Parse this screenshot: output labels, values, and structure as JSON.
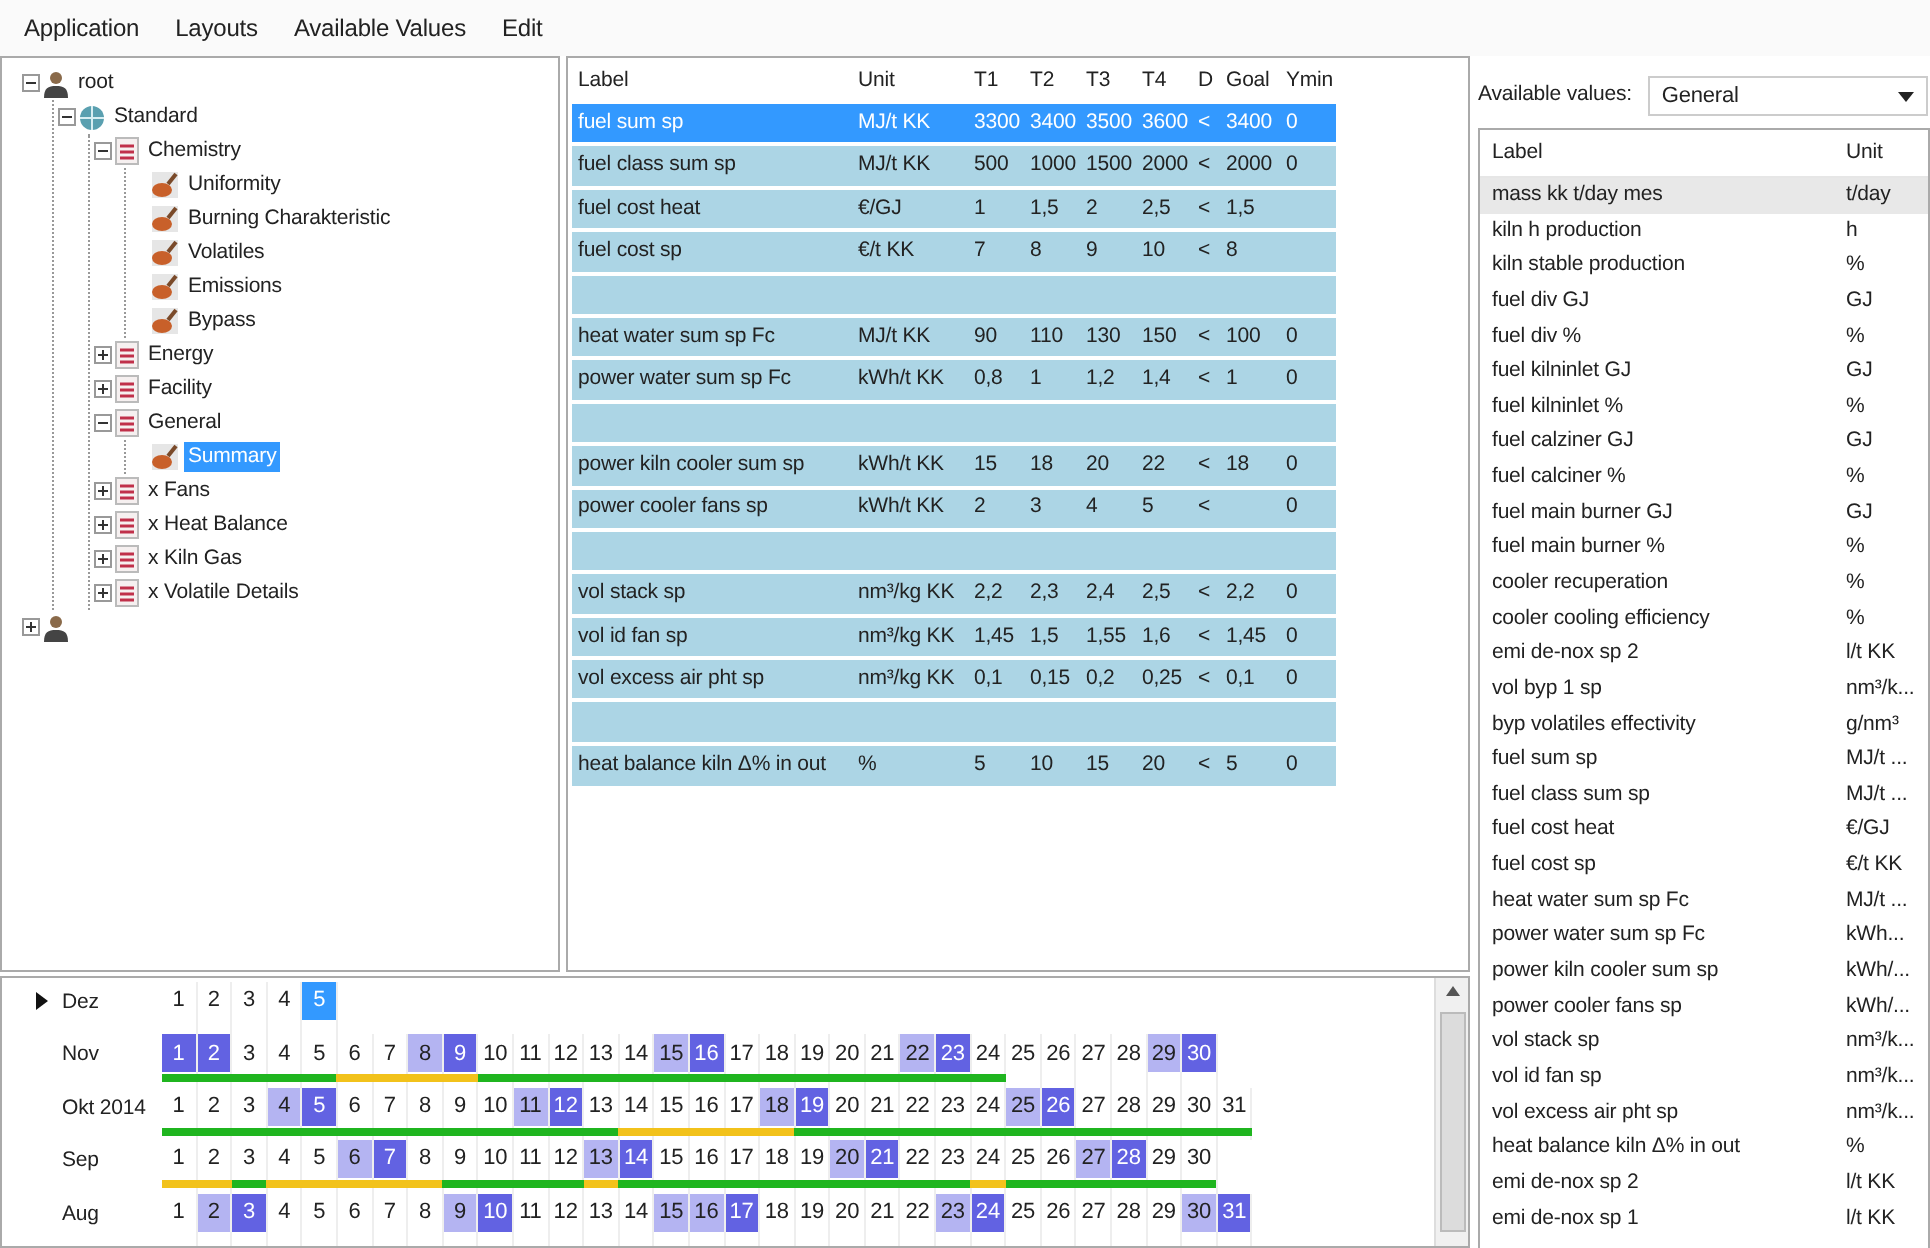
{
  "menu": [
    "Application",
    "Layouts",
    "Available Values",
    "Edit"
  ],
  "tree": [
    {
      "kind": "user",
      "label": "root",
      "expanded": true,
      "selected": false,
      "children": [
        {
          "kind": "model",
          "label": "Standard",
          "expanded": true,
          "selected": false,
          "children": [
            {
              "kind": "group",
              "label": "Chemistry",
              "expanded": true,
              "selected": false,
              "children": [
                {
                  "kind": "item",
                  "label": "Uniformity",
                  "selected": false
                },
                {
                  "kind": "item",
                  "label": "Burning Charakteristic",
                  "selected": false
                },
                {
                  "kind": "item",
                  "label": "Volatiles",
                  "selected": false
                },
                {
                  "kind": "item",
                  "label": "Emissions",
                  "selected": false
                },
                {
                  "kind": "item",
                  "label": "Bypass",
                  "selected": false
                }
              ]
            },
            {
              "kind": "group",
              "label": "Energy",
              "expanded": false,
              "selected": false
            },
            {
              "kind": "group",
              "label": "Facility",
              "expanded": false,
              "selected": false
            },
            {
              "kind": "group",
              "label": "General",
              "expanded": true,
              "selected": false,
              "children": [
                {
                  "kind": "item",
                  "label": "Summary",
                  "selected": true
                }
              ]
            },
            {
              "kind": "group",
              "label": "x Fans",
              "expanded": false,
              "selected": false
            },
            {
              "kind": "group",
              "label": "x Heat Balance",
              "expanded": false,
              "selected": false
            },
            {
              "kind": "group",
              "label": "x Kiln Gas",
              "expanded": false,
              "selected": false
            },
            {
              "kind": "group",
              "label": "x Volatile Details",
              "expanded": false,
              "selected": false
            }
          ]
        }
      ]
    },
    {
      "kind": "user",
      "expanded": false
    }
  ],
  "table": {
    "columns": [
      "Label",
      "Unit",
      "T1",
      "T2",
      "T3",
      "T4",
      "D",
      "Goal",
      "Ymin"
    ],
    "rows": [
      {
        "kind": "data",
        "selected": true,
        "cells": [
          "fuel sum sp",
          "MJ/t KK",
          "3300",
          "3400",
          "3500",
          "3600",
          "<",
          "3400",
          "0"
        ]
      },
      {
        "kind": "data",
        "selected": false,
        "cells": [
          "fuel class sum sp",
          "MJ/t KK",
          "500",
          "1000",
          "1500",
          "2000",
          "<",
          "2000",
          "0"
        ]
      },
      {
        "kind": "data",
        "selected": false,
        "cells": [
          "fuel cost heat",
          "€/GJ",
          "1",
          "1,5",
          "2",
          "2,5",
          "<",
          "1,5",
          null
        ]
      },
      {
        "kind": "data",
        "selected": false,
        "cells": [
          "fuel cost sp",
          "€/t KK",
          "7",
          "8",
          "9",
          "10",
          "<",
          "8",
          null
        ]
      },
      {
        "kind": "blank",
        "selected": false
      },
      {
        "kind": "data",
        "selected": false,
        "cells": [
          "heat water sum sp Fc",
          "MJ/t KK",
          "90",
          "110",
          "130",
          "150",
          "<",
          "100",
          "0"
        ]
      },
      {
        "kind": "data",
        "selected": false,
        "cells": [
          "power water sum sp Fc",
          "kWh/t KK",
          "0,8",
          "1",
          "1,2",
          "1,4",
          "<",
          "1",
          "0"
        ]
      },
      {
        "kind": "blank",
        "selected": false
      },
      {
        "kind": "data",
        "selected": false,
        "cells": [
          "power kiln cooler sum sp",
          "kWh/t KK",
          "15",
          "18",
          "20",
          "22",
          "<",
          "18",
          "0"
        ]
      },
      {
        "kind": "data",
        "selected": false,
        "cells": [
          "power cooler fans sp",
          "kWh/t KK",
          "2",
          "3",
          "4",
          "5",
          "<",
          null,
          "0"
        ]
      },
      {
        "kind": "blank",
        "selected": false
      },
      {
        "kind": "data",
        "selected": false,
        "cells": [
          "vol stack sp",
          "nm³/kg KK",
          "2,2",
          "2,3",
          "2,4",
          "2,5",
          "<",
          "2,2",
          "0"
        ]
      },
      {
        "kind": "data",
        "selected": false,
        "cells": [
          "vol id fan sp",
          "nm³/kg KK",
          "1,45",
          "1,5",
          "1,55",
          "1,6",
          "<",
          "1,45",
          "0"
        ]
      },
      {
        "kind": "data",
        "selected": false,
        "cells": [
          "vol excess air pht sp",
          "nm³/kg KK",
          "0,1",
          "0,15",
          "0,2",
          "0,25",
          "<",
          "0,1",
          "0"
        ]
      },
      {
        "kind": "blank",
        "selected": false
      },
      {
        "kind": "data",
        "selected": false,
        "cells": [
          "heat balance kiln Δ% in out",
          "%",
          "5",
          "10",
          "15",
          "20",
          "<",
          "5",
          "0"
        ]
      }
    ]
  },
  "calendar": {
    "months": [
      {
        "label": "Dez",
        "current": true,
        "days": [
          {
            "day": "1",
            "kind": "plain"
          },
          {
            "day": "2",
            "kind": "plain"
          },
          {
            "day": "3",
            "kind": "plain"
          },
          {
            "day": "4",
            "kind": "plain"
          },
          {
            "day": "5",
            "kind": "current"
          }
        ]
      },
      {
        "label": "Nov",
        "current": false,
        "days": [
          {
            "day": "1",
            "kind": "dark",
            "color": "#1fb51f"
          },
          {
            "day": "2",
            "kind": "dark",
            "color": "#1fb51f"
          },
          {
            "day": "3",
            "kind": "plain",
            "color": "#1fb51f"
          },
          {
            "day": "4",
            "kind": "plain",
            "color": "#1fb51f"
          },
          {
            "day": "5",
            "kind": "plain",
            "color": "#1fb51f"
          },
          {
            "day": "6",
            "kind": "plain",
            "color": "#f2c21b"
          },
          {
            "day": "7",
            "kind": "plain",
            "color": "#f2c21b"
          },
          {
            "day": "8",
            "kind": "light",
            "color": "#f2c21b"
          },
          {
            "day": "9",
            "kind": "dark",
            "color": "#f2c21b"
          },
          {
            "day": "10",
            "kind": "plain",
            "color": "#1fb51f"
          },
          {
            "day": "11",
            "kind": "plain",
            "color": "#1fb51f"
          },
          {
            "day": "12",
            "kind": "plain",
            "color": "#1fb51f"
          },
          {
            "day": "13",
            "kind": "plain",
            "color": "#1fb51f"
          },
          {
            "day": "14",
            "kind": "plain",
            "color": "#1fb51f"
          },
          {
            "day": "15",
            "kind": "light",
            "color": "#1fb51f"
          },
          {
            "day": "16",
            "kind": "dark",
            "color": "#1fb51f"
          },
          {
            "day": "17",
            "kind": "plain",
            "color": "#1fb51f"
          },
          {
            "day": "18",
            "kind": "plain",
            "color": "#1fb51f"
          },
          {
            "day": "19",
            "kind": "plain",
            "color": "#1fb51f"
          },
          {
            "day": "20",
            "kind": "plain",
            "color": "#1fb51f"
          },
          {
            "day": "21",
            "kind": "plain",
            "color": "#1fb51f"
          },
          {
            "day": "22",
            "kind": "light",
            "color": "#1fb51f"
          },
          {
            "day": "23",
            "kind": "dark",
            "color": "#1fb51f"
          },
          {
            "day": "24",
            "kind": "plain",
            "color": "#1fb51f"
          },
          {
            "day": "25",
            "kind": "plain"
          },
          {
            "day": "26",
            "kind": "plain"
          },
          {
            "day": "27",
            "kind": "plain"
          },
          {
            "day": "28",
            "kind": "plain"
          },
          {
            "day": "29",
            "kind": "light"
          },
          {
            "day": "30",
            "kind": "dark"
          }
        ]
      },
      {
        "label": "Okt 2014",
        "current": false,
        "days": [
          {
            "day": "1",
            "kind": "plain",
            "color": "#1fb51f"
          },
          {
            "day": "2",
            "kind": "plain",
            "color": "#1fb51f"
          },
          {
            "day": "3",
            "kind": "plain",
            "color": "#1fb51f"
          },
          {
            "day": "4",
            "kind": "light",
            "color": "#1fb51f"
          },
          {
            "day": "5",
            "kind": "dark",
            "color": "#1fb51f"
          },
          {
            "day": "6",
            "kind": "plain",
            "color": "#1fb51f"
          },
          {
            "day": "7",
            "kind": "plain",
            "color": "#1fb51f"
          },
          {
            "day": "8",
            "kind": "plain",
            "color": "#1fb51f"
          },
          {
            "day": "9",
            "kind": "plain",
            "color": "#1fb51f"
          },
          {
            "day": "10",
            "kind": "plain",
            "color": "#1fb51f"
          },
          {
            "day": "11",
            "kind": "light",
            "color": "#1fb51f"
          },
          {
            "day": "12",
            "kind": "dark",
            "color": "#1fb51f"
          },
          {
            "day": "13",
            "kind": "plain",
            "color": "#1fb51f"
          },
          {
            "day": "14",
            "kind": "plain",
            "color": "#f2c21b"
          },
          {
            "day": "15",
            "kind": "plain",
            "color": "#f2c21b"
          },
          {
            "day": "16",
            "kind": "plain",
            "color": "#f2c21b"
          },
          {
            "day": "17",
            "kind": "plain",
            "color": "#f2c21b"
          },
          {
            "day": "18",
            "kind": "light",
            "color": "#f2c21b"
          },
          {
            "day": "19",
            "kind": "dark",
            "color": "#1fb51f"
          },
          {
            "day": "20",
            "kind": "plain",
            "color": "#1fb51f"
          },
          {
            "day": "21",
            "kind": "plain",
            "color": "#1fb51f"
          },
          {
            "day": "22",
            "kind": "plain",
            "color": "#1fb51f"
          },
          {
            "day": "23",
            "kind": "plain",
            "color": "#1fb51f"
          },
          {
            "day": "24",
            "kind": "plain",
            "color": "#1fb51f"
          },
          {
            "day": "25",
            "kind": "light",
            "color": "#1fb51f"
          },
          {
            "day": "26",
            "kind": "dark",
            "color": "#1fb51f"
          },
          {
            "day": "27",
            "kind": "plain",
            "color": "#1fb51f"
          },
          {
            "day": "28",
            "kind": "plain",
            "color": "#1fb51f"
          },
          {
            "day": "29",
            "kind": "plain",
            "color": "#1fb51f"
          },
          {
            "day": "30",
            "kind": "plain",
            "color": "#1fb51f"
          },
          {
            "day": "31",
            "kind": "plain",
            "color": "#1fb51f"
          }
        ]
      },
      {
        "label": "Sep",
        "current": false,
        "days": [
          {
            "day": "1",
            "kind": "plain",
            "color": "#f2c21b"
          },
          {
            "day": "2",
            "kind": "plain",
            "color": "#f2c21b"
          },
          {
            "day": "3",
            "kind": "plain",
            "color": "#1fb51f"
          },
          {
            "day": "4",
            "kind": "plain",
            "color": "#f2c21b"
          },
          {
            "day": "5",
            "kind": "plain",
            "color": "#f2c21b"
          },
          {
            "day": "6",
            "kind": "light",
            "color": "#f2c21b"
          },
          {
            "day": "7",
            "kind": "dark",
            "color": "#f2c21b"
          },
          {
            "day": "8",
            "kind": "plain",
            "color": "#f2c21b"
          },
          {
            "day": "9",
            "kind": "plain",
            "color": "#1fb51f"
          },
          {
            "day": "10",
            "kind": "plain",
            "color": "#1fb51f"
          },
          {
            "day": "11",
            "kind": "plain",
            "color": "#1fb51f"
          },
          {
            "day": "12",
            "kind": "plain",
            "color": "#1fb51f"
          },
          {
            "day": "13",
            "kind": "light",
            "color": "#f2c21b"
          },
          {
            "day": "14",
            "kind": "dark",
            "color": "#1fb51f"
          },
          {
            "day": "15",
            "kind": "plain",
            "color": "#1fb51f"
          },
          {
            "day": "16",
            "kind": "plain",
            "color": "#1fb51f"
          },
          {
            "day": "17",
            "kind": "plain",
            "color": "#1fb51f"
          },
          {
            "day": "18",
            "kind": "plain",
            "color": "#1fb51f"
          },
          {
            "day": "19",
            "kind": "plain",
            "color": "#1fb51f"
          },
          {
            "day": "20",
            "kind": "light",
            "color": "#1fb51f"
          },
          {
            "day": "21",
            "kind": "dark",
            "color": "#1fb51f"
          },
          {
            "day": "22",
            "kind": "plain",
            "color": "#1fb51f"
          },
          {
            "day": "23",
            "kind": "plain",
            "color": "#1fb51f"
          },
          {
            "day": "24",
            "kind": "plain",
            "color": "#f2c21b"
          },
          {
            "day": "25",
            "kind": "plain",
            "color": "#1fb51f"
          },
          {
            "day": "26",
            "kind": "plain",
            "color": "#1fb51f"
          },
          {
            "day": "27",
            "kind": "light",
            "color": "#1fb51f"
          },
          {
            "day": "28",
            "kind": "dark",
            "color": "#1fb51f"
          },
          {
            "day": "29",
            "kind": "plain",
            "color": "#1fb51f"
          },
          {
            "day": "30",
            "kind": "plain",
            "color": "#1fb51f"
          }
        ]
      },
      {
        "label": "Aug",
        "current": false,
        "days": [
          {
            "day": "1",
            "kind": "plain"
          },
          {
            "day": "2",
            "kind": "light"
          },
          {
            "day": "3",
            "kind": "dark"
          },
          {
            "day": "4",
            "kind": "plain"
          },
          {
            "day": "5",
            "kind": "plain"
          },
          {
            "day": "6",
            "kind": "plain"
          },
          {
            "day": "7",
            "kind": "plain"
          },
          {
            "day": "8",
            "kind": "plain"
          },
          {
            "day": "9",
            "kind": "light"
          },
          {
            "day": "10",
            "kind": "dark"
          },
          {
            "day": "11",
            "kind": "plain"
          },
          {
            "day": "12",
            "kind": "plain"
          },
          {
            "day": "13",
            "kind": "plain"
          },
          {
            "day": "14",
            "kind": "plain"
          },
          {
            "day": "15",
            "kind": "light"
          },
          {
            "day": "16",
            "kind": "light"
          },
          {
            "day": "17",
            "kind": "dark"
          },
          {
            "day": "18",
            "kind": "plain"
          },
          {
            "day": "19",
            "kind": "plain"
          },
          {
            "day": "20",
            "kind": "plain"
          },
          {
            "day": "21",
            "kind": "plain"
          },
          {
            "day": "22",
            "kind": "plain"
          },
          {
            "day": "23",
            "kind": "light"
          },
          {
            "day": "24",
            "kind": "dark"
          },
          {
            "day": "25",
            "kind": "plain"
          },
          {
            "day": "26",
            "kind": "plain"
          },
          {
            "day": "27",
            "kind": "plain"
          },
          {
            "day": "28",
            "kind": "plain"
          },
          {
            "day": "29",
            "kind": "plain"
          },
          {
            "day": "30",
            "kind": "light"
          },
          {
            "day": "31",
            "kind": "dark"
          }
        ]
      }
    ]
  },
  "available": {
    "label": "Available values:",
    "dropdown": "General",
    "columns": [
      "Label",
      "Unit"
    ],
    "rows": [
      {
        "label": "mass kk t/day mes",
        "unit": "t/day",
        "selected": true
      },
      {
        "label": "kiln h production",
        "unit": "h",
        "selected": false
      },
      {
        "label": "kiln stable production",
        "unit": "%",
        "selected": false
      },
      {
        "label": "fuel div GJ",
        "unit": "GJ",
        "selected": false
      },
      {
        "label": "fuel div %",
        "unit": "%",
        "selected": false
      },
      {
        "label": "fuel kilninlet GJ",
        "unit": "GJ",
        "selected": false
      },
      {
        "label": "fuel kilninlet %",
        "unit": "%",
        "selected": false
      },
      {
        "label": "fuel calziner GJ",
        "unit": "GJ",
        "selected": false
      },
      {
        "label": "fuel calciner %",
        "unit": "%",
        "selected": false
      },
      {
        "label": "fuel main burner GJ",
        "unit": "GJ",
        "selected": false
      },
      {
        "label": "fuel main burner %",
        "unit": "%",
        "selected": false
      },
      {
        "label": "cooler recuperation",
        "unit": "%",
        "selected": false
      },
      {
        "label": "cooler cooling efficiency",
        "unit": "%",
        "selected": false
      },
      {
        "label": "emi de-nox sp 2",
        "unit": "l/t KK",
        "selected": false
      },
      {
        "label": "vol byp 1 sp",
        "unit": "nm³/k...",
        "selected": false
      },
      {
        "label": "byp volatiles effectivity",
        "unit": "g/nm³",
        "selected": false
      },
      {
        "label": "fuel sum sp",
        "unit": "MJ/t ...",
        "selected": false
      },
      {
        "label": "fuel class sum sp",
        "unit": "MJ/t ...",
        "selected": false
      },
      {
        "label": "fuel cost heat",
        "unit": "€/GJ",
        "selected": false
      },
      {
        "label": "fuel cost sp",
        "unit": "€/t KK",
        "selected": false
      },
      {
        "label": "heat water sum sp Fc",
        "unit": "MJ/t ...",
        "selected": false
      },
      {
        "label": "power water sum sp Fc",
        "unit": "kWh...",
        "selected": false
      },
      {
        "label": "power kiln cooler sum sp",
        "unit": "kWh/...",
        "selected": false
      },
      {
        "label": "power cooler fans sp",
        "unit": "kWh/...",
        "selected": false
      },
      {
        "label": "vol stack sp",
        "unit": "nm³/k...",
        "selected": false
      },
      {
        "label": "vol id fan sp",
        "unit": "nm³/k...",
        "selected": false
      },
      {
        "label": "vol excess air pht sp",
        "unit": "nm³/k...",
        "selected": false
      },
      {
        "label": "heat balance kiln Δ% in out",
        "unit": "%",
        "selected": false
      },
      {
        "label": "emi de-nox sp 2",
        "unit": "l/t KK",
        "selected": false
      },
      {
        "label": "emi de-nox sp 1",
        "unit": "l/t KK",
        "selected": false
      }
    ]
  }
}
